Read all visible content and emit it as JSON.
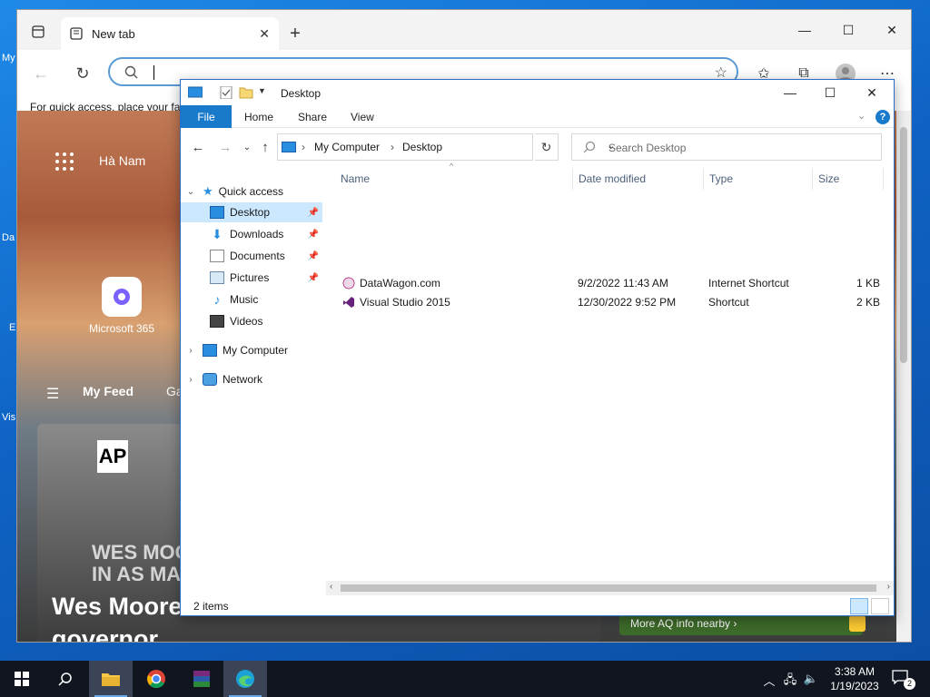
{
  "desktop": {
    "icon_fragments": [
      "My",
      "Da",
      "E",
      "Vis"
    ]
  },
  "browser": {
    "tab_title": "New tab",
    "address_value": "",
    "favbar_text": "For quick access, place your fa",
    "ntp": {
      "location": "Hà Nam",
      "tile_label": "Microsoft 365",
      "feed_tab": "My Feed",
      "feed_tab2": "Ga",
      "news_source": "AP",
      "news_overlay": "WES MOO\nIN AS MA",
      "news_headline_line1": "Wes Moore",
      "news_headline_line2": "governor",
      "aq_button": "More AQ info nearby ›"
    }
  },
  "explorer": {
    "title": "Desktop",
    "ribbon_tabs": [
      "File",
      "Home",
      "Share",
      "View"
    ],
    "breadcrumb": [
      "My Computer",
      "Desktop"
    ],
    "search_placeholder": "Search Desktop",
    "nav": {
      "quick_access": "Quick access",
      "quick_items": [
        "Desktop",
        "Downloads",
        "Documents",
        "Pictures",
        "Music",
        "Videos"
      ],
      "my_computer": "My Computer",
      "network": "Network"
    },
    "columns": [
      "Name",
      "Date modified",
      "Type",
      "Size"
    ],
    "files": [
      {
        "name": "DataWagon.com",
        "date": "9/2/2022 11:43 AM",
        "type": "Internet Shortcut",
        "size": "1 KB"
      },
      {
        "name": "Visual Studio 2015",
        "date": "12/30/2022 9:52 PM",
        "type": "Shortcut",
        "size": "2 KB"
      }
    ],
    "status_count": "2 items"
  },
  "taskbar": {
    "time": "3:38 AM",
    "date": "1/19/2023",
    "notification_count": "2"
  },
  "colors": {
    "accent": "#1979ca",
    "selection": "#cce8ff",
    "taskbar": "#101520"
  }
}
